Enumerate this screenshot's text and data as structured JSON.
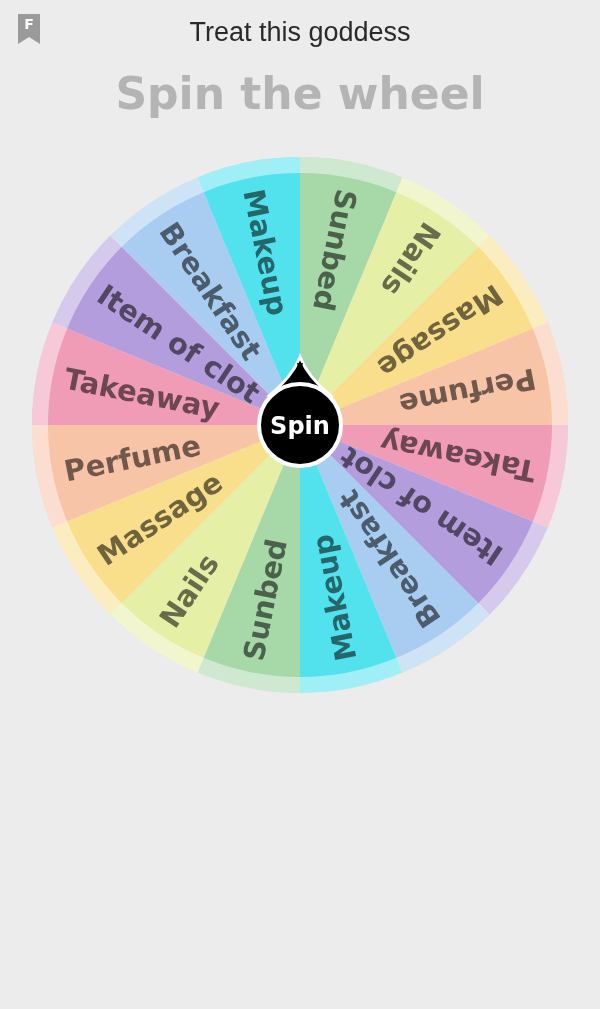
{
  "badge": "F",
  "title": "Treat this goddess",
  "heading": "Spin the wheel",
  "wheel": {
    "segments": [
      {
        "label": "Sunbed",
        "color": "#a6d8a8"
      },
      {
        "label": "Nails",
        "color": "#e6efa6"
      },
      {
        "label": "Massage",
        "color": "#f9df8c"
      },
      {
        "label": "Perfume",
        "color": "#f8c4a8"
      },
      {
        "label": "Takeaway",
        "color": "#f09cb6"
      },
      {
        "label": "Item of clot",
        "color": "#b39ddc"
      },
      {
        "label": "Breakfast",
        "color": "#a8cdf0"
      },
      {
        "label": "Makeup",
        "color": "#52e2ee"
      },
      {
        "label": "Sunbed",
        "color": "#a6d8a8"
      },
      {
        "label": "Nails",
        "color": "#e6efa6"
      },
      {
        "label": "Massage",
        "color": "#f9df8c"
      },
      {
        "label": "Perfume",
        "color": "#f8c4a8"
      },
      {
        "label": "Takeaway",
        "color": "#f09cb6"
      },
      {
        "label": "Item of clot",
        "color": "#b39ddc"
      },
      {
        "label": "Breakfast",
        "color": "#a8cdf0"
      },
      {
        "label": "Makeup",
        "color": "#52e2ee"
      }
    ],
    "button": "Spin"
  }
}
